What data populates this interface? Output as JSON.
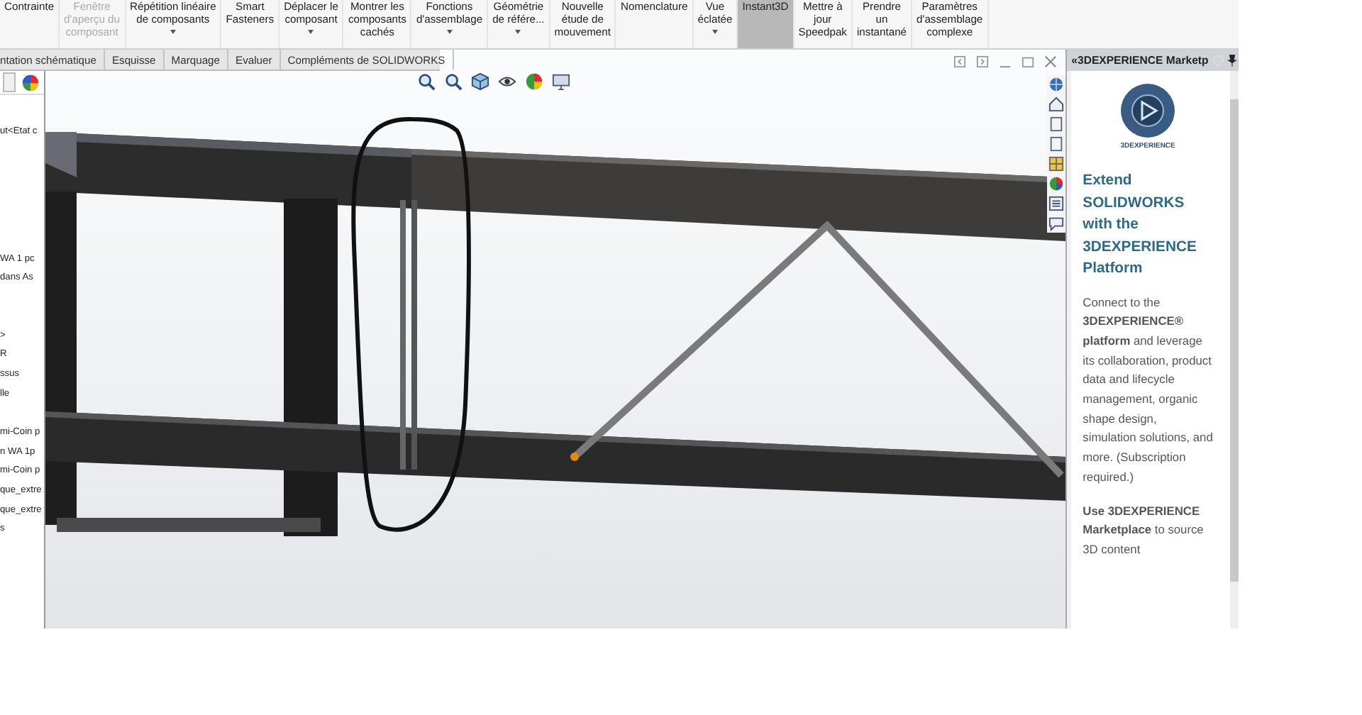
{
  "ribbon": {
    "buttons": [
      {
        "label": "Contrainte",
        "disabled": false,
        "selected": false,
        "dropdown": false
      },
      {
        "label": "Fenêtre\nd'aperçu du\ncomposant",
        "disabled": true,
        "selected": false,
        "dropdown": false
      },
      {
        "label": "Répétition linéaire\nde composants",
        "disabled": false,
        "selected": false,
        "dropdown": true
      },
      {
        "label": "Smart\nFasteners",
        "disabled": false,
        "selected": false,
        "dropdown": false
      },
      {
        "label": "Déplacer le\ncomposant",
        "disabled": false,
        "selected": false,
        "dropdown": true
      },
      {
        "label": "Montrer les\ncomposants\ncachés",
        "disabled": false,
        "selected": false,
        "dropdown": false
      },
      {
        "label": "Fonctions\nd'assemblage",
        "disabled": false,
        "selected": false,
        "dropdown": true
      },
      {
        "label": "Géométrie\nde référe...",
        "disabled": false,
        "selected": false,
        "dropdown": true
      },
      {
        "label": "Nouvelle\nétude de\nmouvement",
        "disabled": false,
        "selected": false,
        "dropdown": false
      },
      {
        "label": "Nomenclature",
        "disabled": false,
        "selected": false,
        "dropdown": false
      },
      {
        "label": "Vue\néclatée",
        "disabled": false,
        "selected": false,
        "dropdown": true
      },
      {
        "label": "Instant3D",
        "disabled": false,
        "selected": true,
        "dropdown": false
      },
      {
        "label": "Mettre à\njour\nSpeedpak",
        "disabled": false,
        "selected": false,
        "dropdown": false
      },
      {
        "label": "Prendre\nun\ninstantané",
        "disabled": false,
        "selected": false,
        "dropdown": false
      },
      {
        "label": "Paramètres\nd'assemblage\ncomplexe",
        "disabled": false,
        "selected": false,
        "dropdown": false
      }
    ]
  },
  "tabs": [
    "ntation schématique",
    "Esquisse",
    "Marquage",
    "Evaluer",
    "Compléments de SOLIDWORKS"
  ],
  "tree": {
    "groups": [
      [
        "ut<Etat c"
      ],
      [
        "WA 1 pc",
        "dans As"
      ],
      [
        ">",
        "R",
        "ssus",
        "lle"
      ],
      [
        "mi-Coin p",
        "n WA 1p",
        "mi-Coin p",
        "que_extre",
        "que_extre",
        "s"
      ]
    ]
  },
  "marketplace": {
    "title": "«3DEXPERIENCE Marketp",
    "logo_text": "3DEXPERIENCE",
    "heading": "Extend SOLIDWORKS with the 3DEXPERIENCE Platform",
    "paragraphs": [
      "Connect to the **3DEXPERIENCE® platform** and leverage its collaboration, product data and lifecycle management, organic shape design, simulation solutions, and more. (Subscription required.)",
      "**Use 3DEXPERIENCE Marketplace** to source 3D content"
    ]
  }
}
